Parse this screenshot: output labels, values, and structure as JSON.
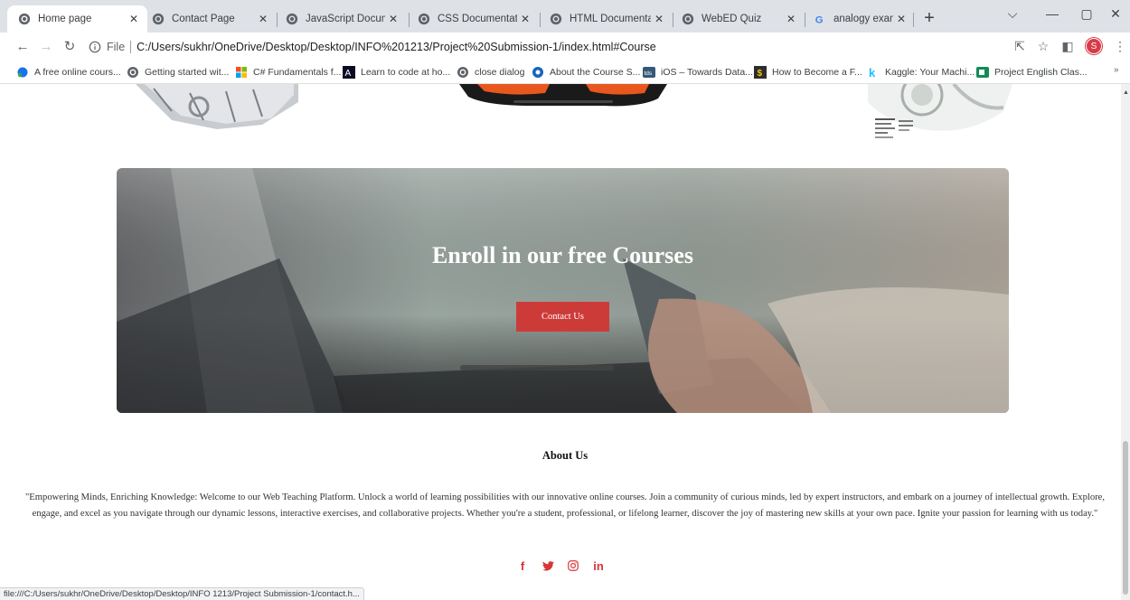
{
  "browser": {
    "tabs": [
      {
        "title": "Home page",
        "favicon": "globe-icon",
        "active": true
      },
      {
        "title": "Contact Page",
        "favicon": "globe-icon"
      },
      {
        "title": "JavaScript Documentati",
        "favicon": "globe-icon"
      },
      {
        "title": "CSS Documentation",
        "favicon": "globe-icon"
      },
      {
        "title": "HTML Documentation",
        "favicon": "globe-icon"
      },
      {
        "title": "WebED Quiz",
        "favicon": "globe-icon"
      },
      {
        "title": "analogy examples - G",
        "favicon": "google-icon"
      }
    ],
    "address": {
      "scheme": "File",
      "url": "C:/Users/sukhr/OneDrive/Desktop/Desktop/INFO%201213/Project%20Submission-1/index.html#Course"
    },
    "profile_initial": "S",
    "bookmarks": [
      {
        "label": "A free online cours...",
        "icon": "blue-dot-icon"
      },
      {
        "label": "Getting started wit...",
        "icon": "globe-icon"
      },
      {
        "label": "C# Fundamentals f...",
        "icon": "microsoft-icon"
      },
      {
        "label": "Learn to code at ho...",
        "icon": "freecodecamp-icon"
      },
      {
        "label": "close dialog",
        "icon": "globe-icon"
      },
      {
        "label": "About the Course S...",
        "icon": "blue-circle-icon"
      },
      {
        "label": "iOS – Towards Data...",
        "icon": "tds-icon"
      },
      {
        "label": "How to Become a F...",
        "icon": "dollar-icon"
      },
      {
        "label": "Kaggle: Your Machi...",
        "icon": "kaggle-icon"
      },
      {
        "label": "Project English Clas...",
        "icon": "teams-icon"
      }
    ],
    "more_bookmarks": "»",
    "status_url": "file:///C:/Users/sukhr/OneDrive/Desktop/Desktop/INFO 1213/Project Submission-1/contact.h..."
  },
  "page": {
    "hero": {
      "title": "Enroll in our free Courses",
      "button_label": "Contact Us"
    },
    "about": {
      "title": "About Us",
      "text": "\"Empowering Minds, Enriching Knowledge: Welcome to our Web Teaching Platform. Unlock a world of learning possibilities with our innovative online courses. Join a community of curious minds, led by expert instructors, and embark on a journey of intellectual growth. Explore, engage, and excel as you navigate through our dynamic lessons, interactive exercises, and collaborative projects. Whether you're a student, professional, or lifelong learner, discover the joy of mastering new skills at your own pace. Ignite your passion for learning with us today.\""
    },
    "socials": [
      {
        "label": "f",
        "name": "facebook-icon"
      },
      {
        "label": "✔",
        "name": "twitter-icon"
      },
      {
        "label": "◎",
        "name": "instagram-icon"
      },
      {
        "label": "in",
        "name": "linkedin-icon"
      }
    ]
  },
  "colors": {
    "accent": "#cd3b39",
    "social": "#d8353a",
    "tabstrip": "#dee1e6",
    "profile": "#d93a48"
  }
}
